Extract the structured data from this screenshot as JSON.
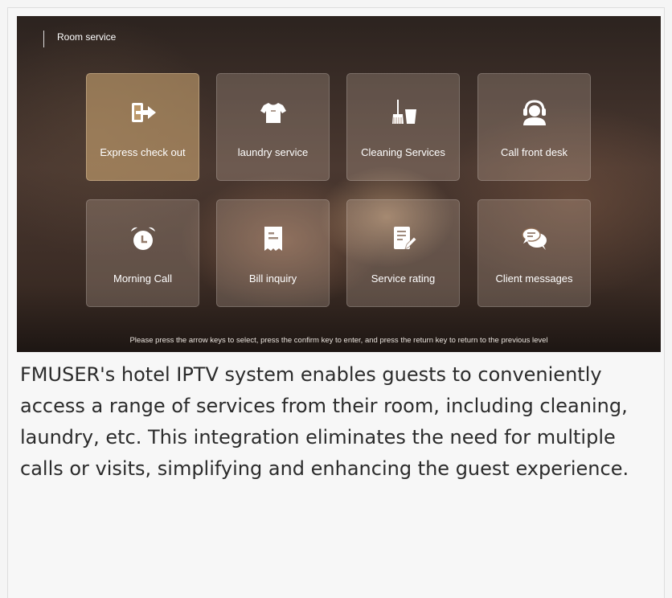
{
  "screen": {
    "title": "Room service",
    "hint": "Please press the arrow keys to select, press the confirm key to enter, and press the return key to return to the previous level"
  },
  "tiles": [
    {
      "label": "Express check out",
      "icon": "check-out-icon"
    },
    {
      "label": "laundry service",
      "icon": "shirt-icon"
    },
    {
      "label": "Cleaning Services",
      "icon": "broom-bucket-icon"
    },
    {
      "label": "Call front desk",
      "icon": "headset-icon"
    },
    {
      "label": "Morning Call",
      "icon": "alarm-clock-icon"
    },
    {
      "label": "Bill inquiry",
      "icon": "receipt-icon"
    },
    {
      "label": "Service rating",
      "icon": "edit-document-icon"
    },
    {
      "label": "Client messages",
      "icon": "chat-bubbles-icon"
    }
  ],
  "caption": "FMUSER's hotel IPTV system enables guests to conveniently access a range of services from their room, including cleaning, laundry, etc. This integration eliminates the need for multiple calls or visits, simplifying and enhancing the guest experience."
}
